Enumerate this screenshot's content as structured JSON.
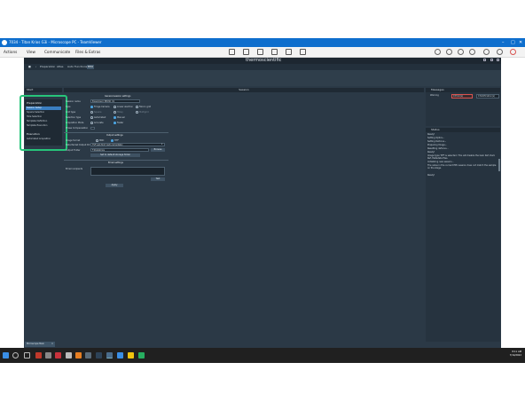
{
  "teamviewer": {
    "title": "7034 - Titan Krios G3i - Microscope PC - TeamViewer",
    "menu": {
      "actions": "Actions",
      "view": "View",
      "communicate": "Communicate",
      "files_extras": "Files & Extras"
    }
  },
  "app": {
    "brand": "thermoscientific",
    "tabs": [
      "Preparation",
      "Atlas",
      "Auto Functions",
      "EPU"
    ],
    "active_tab": "EPU"
  },
  "workflow": {
    "start_label": "Start",
    "preparation_header": "Preparation",
    "preparation_items": [
      "Session Setup",
      "Square Selection",
      "Hole Selection",
      "Template Definition",
      "Template Execution"
    ],
    "execution_header": "Execution",
    "execution_items": [
      "Automated Acquisition"
    ]
  },
  "session": {
    "header": "Session",
    "general_title": "General session settings",
    "fields": {
      "name_label": "Session name",
      "name_value": "Experiment_EPU3D_01",
      "type_label": "Type",
      "type_options": [
        "Fringe Camera",
        "Linear electron",
        "Falcon grid"
      ],
      "grid_label": "Grid type",
      "grid_options": [
        "Square",
        "Holey",
        "Multigrid"
      ],
      "selection_label": "Selection type",
      "selection_options": [
        "Automated",
        "Manual"
      ],
      "mode_label": "Acquisition Mode",
      "mode_options": [
        "Accurate",
        "Faster"
      ],
      "phase_label": "Phase Compensation"
    },
    "output_title": "Output settings",
    "output": {
      "format_label": "Image format",
      "format_options": [
        "MRC",
        "TIFF"
      ],
      "location_label": "Data Packet Output Dir",
      "location_value": "TSF Last-Shot (auto-remediate)",
      "folder_label": "Output Folder",
      "folder_value": "F:\\Data\\Krios",
      "browse": "Browse",
      "default_button": "Set to default storage folder"
    },
    "email_title": "Email settings",
    "email": {
      "recipient_label": "Email recipients",
      "test_button": "Test"
    },
    "apply_button": "Apply"
  },
  "messages": {
    "header": "Messages",
    "filter_label": "Warning",
    "error_badge": "0 Error(s)",
    "notification_badge": "0 Notification(s)"
  },
  "status": {
    "header": "Status",
    "lines": [
      "Ready!",
      "Setting Optics...",
      "Setting Defocus...",
      "Preparing Image...",
      "Resetting defocus...",
      "Ready!",
      "Image type TIFF is selected. This will disable the Gain Ref, Dark Ref, Metadata files.",
      "Initializing new session...",
      "The value in the current EPU session does not match the sample on the stage.",
      "Ready!"
    ]
  },
  "taskbar": {
    "session_tab": "Microscope Main",
    "time": "8:11 AM",
    "date": "7/14/2022"
  },
  "colors": {
    "highlight": "#27c47a",
    "teamviewer_blue": "#0e6ecd",
    "app_background": "#2b3946",
    "selected_item": "#3a7ec0",
    "error_red": "#d9534f"
  }
}
